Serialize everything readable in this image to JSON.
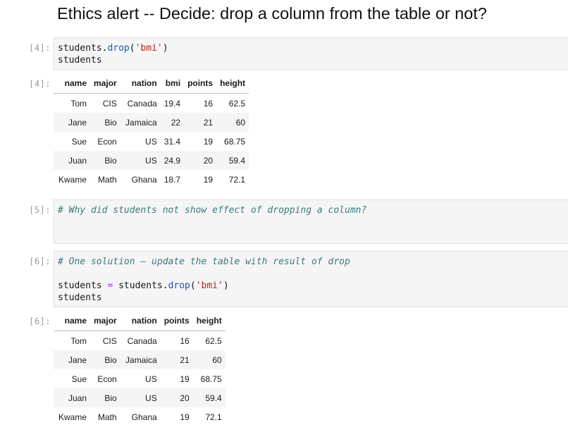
{
  "heading": "Ethics alert -- Decide: drop a column from the table or not?",
  "cells": [
    {
      "prompt": "[4]:",
      "lines": [
        {
          "obj": "students",
          "dot": ".",
          "method": "drop",
          "open": "(",
          "arg": "'bmi'",
          "close": ")"
        },
        {
          "text": "students"
        }
      ]
    },
    {
      "prompt": "[5]:",
      "lines": [
        {
          "comment": "# Why did students not show effect of dropping a column?"
        }
      ]
    },
    {
      "prompt": "[6]:",
      "lines": [
        {
          "comment": "# One solution — update the table with result of drop"
        },
        {
          "lhs": "students",
          "eq": "=",
          "obj": "students",
          "dot": ".",
          "method": "drop",
          "open": "(",
          "arg": "'bmi'",
          "close": ")"
        },
        {
          "text": "students"
        }
      ]
    }
  ],
  "outputs": [
    {
      "prompt": "[4]:",
      "columns": [
        "name",
        "major",
        "nation",
        "bmi",
        "points",
        "height"
      ],
      "rows": [
        [
          "Tom",
          "CIS",
          "Canada",
          "19.4",
          "16",
          "62.5"
        ],
        [
          "Jane",
          "Bio",
          "Jamaica",
          "22",
          "21",
          "60"
        ],
        [
          "Sue",
          "Econ",
          "US",
          "31.4",
          "19",
          "68.75"
        ],
        [
          "Juan",
          "Bio",
          "US",
          "24.9",
          "20",
          "59.4"
        ],
        [
          "Kwame",
          "Math",
          "Ghana",
          "18.7",
          "19",
          "72.1"
        ]
      ]
    },
    {
      "prompt": "[6]:",
      "columns": [
        "name",
        "major",
        "nation",
        "points",
        "height"
      ],
      "rows": [
        [
          "Tom",
          "CIS",
          "Canada",
          "16",
          "62.5"
        ],
        [
          "Jane",
          "Bio",
          "Jamaica",
          "21",
          "60"
        ],
        [
          "Sue",
          "Econ",
          "US",
          "19",
          "68.75"
        ],
        [
          "Juan",
          "Bio",
          "US",
          "20",
          "59.4"
        ],
        [
          "Kwame",
          "Math",
          "Ghana",
          "19",
          "72.1"
        ]
      ]
    }
  ],
  "colors": {
    "method": "#1e56b0",
    "string": "#ba2121",
    "operator": "#aa22ff",
    "comment": "#3d7a7a",
    "prompt": "#9a9a9a",
    "cell_background": "#f5f5f5"
  }
}
